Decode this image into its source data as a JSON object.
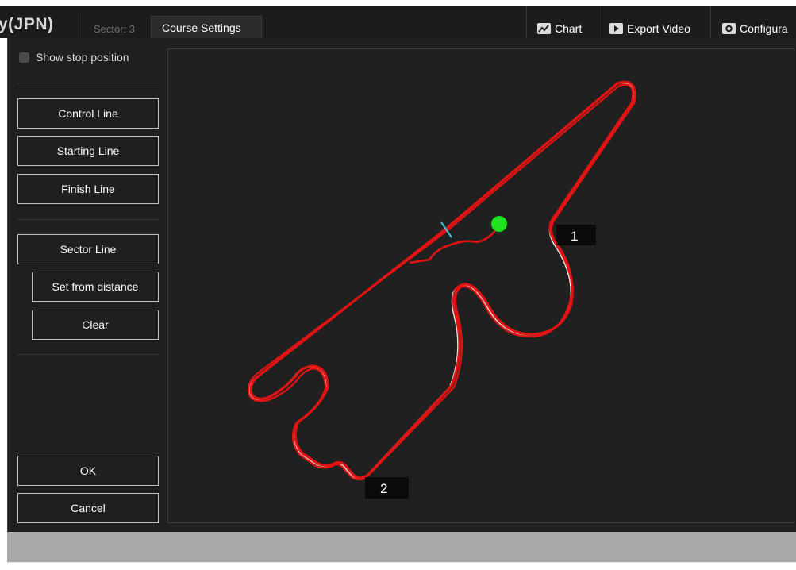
{
  "app": {
    "title_fragment": "y(JPN)",
    "sector_label": "Sector: 3",
    "active_tab": "Course Settings"
  },
  "toolbar": {
    "chart_label": "Chart",
    "chart_icon": "chart-icon",
    "export_label": "Export Video",
    "export_icon": "play-icon",
    "config_label": "Configura",
    "config_icon": "gear-icon"
  },
  "dialog": {
    "show_stop_label": "Show stop position",
    "show_stop_checked": false,
    "buttons": {
      "control_line": "Control Line",
      "starting_line": "Starting Line",
      "finish_line": "Finish Line",
      "sector_line": "Sector Line",
      "set_from_distance": "Set from distance",
      "clear": "Clear",
      "ok": "OK",
      "cancel": "Cancel"
    }
  },
  "map": {
    "sector_markers": [
      "1",
      "2"
    ],
    "colors": {
      "track": "#e11313",
      "reference_line": "#e6e6e6",
      "position_dot": "#1ee31e",
      "control_line": "#35c8e0",
      "marker_bg": "#0b0b0b"
    }
  }
}
